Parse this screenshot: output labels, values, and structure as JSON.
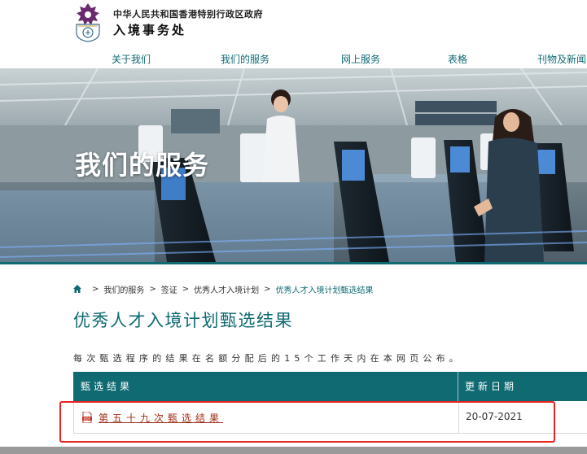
{
  "header": {
    "gov_name": "中华人民共和国香港特别行政区政府",
    "dept_name": "入境事务处",
    "logo_icon": "immigration-emblem-icon"
  },
  "nav": {
    "items": [
      {
        "label": "关于我们"
      },
      {
        "label": "我们的服务"
      },
      {
        "label": "网上服务"
      },
      {
        "label": "表格"
      },
      {
        "label": "刊物及新闻"
      }
    ]
  },
  "hero": {
    "title": "我们的服务"
  },
  "breadcrumb": {
    "home_icon": "home-icon",
    "items": [
      {
        "label": "我们的服务"
      },
      {
        "label": "签证"
      },
      {
        "label": "优秀人才入境计划"
      },
      {
        "label": "优秀人才入境计划甄选结果"
      }
    ],
    "separator": ">"
  },
  "page": {
    "title": "优秀人才入境计划甄选结果",
    "intro": "每次甄选程序的结果在名额分配后的15个工作天内在本网页公布。"
  },
  "table": {
    "headers": {
      "name": "甄选结果",
      "date": "更新日期"
    },
    "rows": [
      {
        "label": "第五十九次甄选结果",
        "date": "20-07-2021",
        "icon": "pdf-icon"
      }
    ]
  },
  "colors": {
    "brand": "#0f6a72",
    "link": "#a0301c",
    "highlight": "#e8231f"
  }
}
